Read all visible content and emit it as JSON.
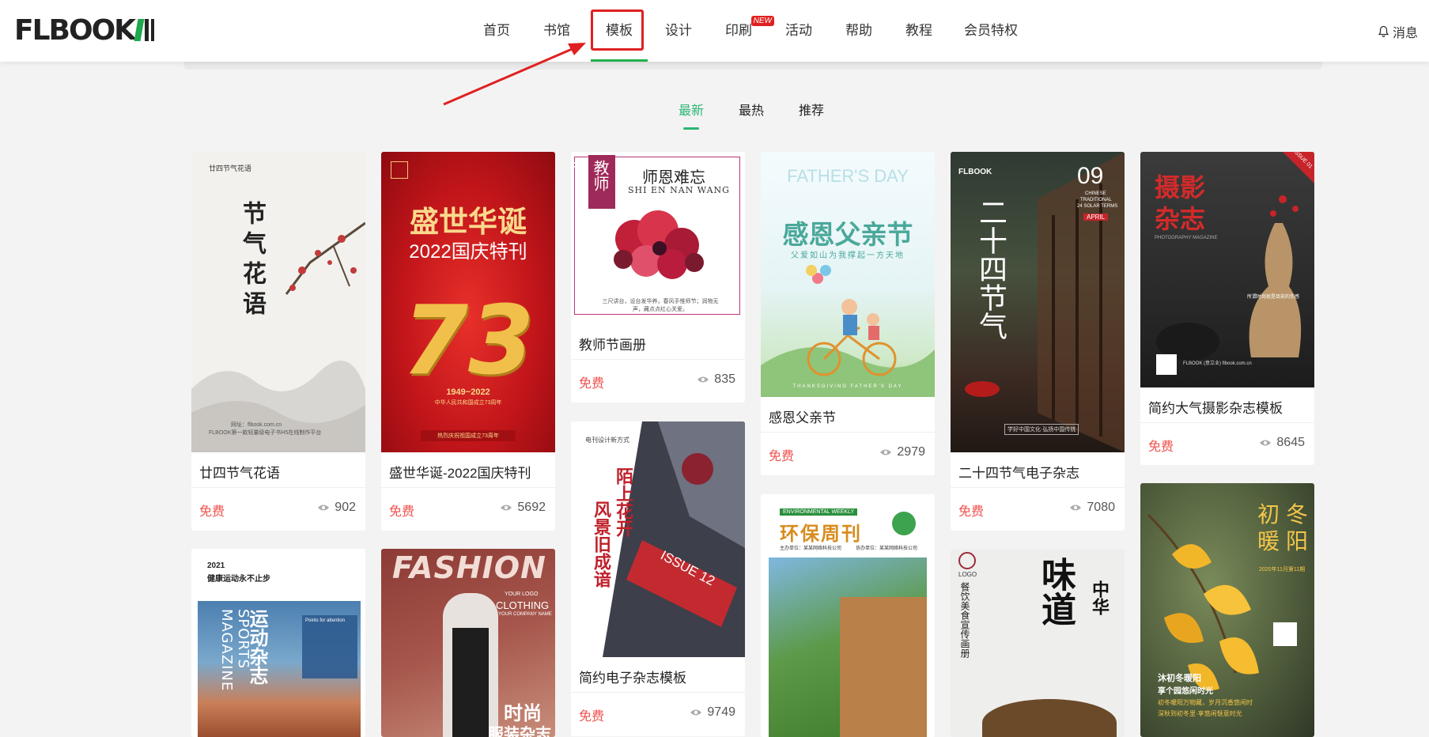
{
  "header": {
    "logo_text": "FLBOOK",
    "nav": [
      {
        "label": "首页"
      },
      {
        "label": "书馆"
      },
      {
        "label": "模板"
      },
      {
        "label": "设计"
      },
      {
        "label": "印刷",
        "badge": "NEW"
      },
      {
        "label": "活动"
      },
      {
        "label": "帮助"
      },
      {
        "label": "教程"
      },
      {
        "label": "会员特权"
      }
    ],
    "active_nav": "模板",
    "messages_label": "消息"
  },
  "tabs": [
    {
      "label": "最新",
      "active": true
    },
    {
      "label": "最热",
      "active": false
    },
    {
      "label": "推荐",
      "active": false
    }
  ],
  "colors": {
    "accent_green": "#21b14a",
    "tab_green": "#2bb673",
    "annotation_red": "#e02020",
    "free_red": "#f0524f"
  },
  "cards": [
    {
      "title": "廿四节气花语",
      "price": "免费",
      "views": "902",
      "thumb": {
        "top_label": "廿四节气花语",
        "main": "节气花语",
        "footer": "网址：flbook.com.cn",
        "footer2": "FLBOOK第一款轻量级电子书H5在线制作平台"
      }
    },
    {
      "title": "盛世华诞-2022国庆特刊",
      "price": "免费",
      "views": "5692",
      "thumb": {
        "headline": "盛世华诞",
        "subhead": "2022国庆特刊",
        "number": "73",
        "years": "1949~2022",
        "caption": "中华人民共和国成立73周年",
        "strip": "热烈庆祝祖国成立73周年"
      }
    },
    {
      "title": "教师节画册",
      "price": "免费",
      "views": "835",
      "thumb": {
        "side": "教师节",
        "heading": "师恩难忘",
        "sub": "SHI EN NAN WANG",
        "poem": "三尺讲台，设台发华养，春风手惟师节；润物无声，藏点点红心关爱。"
      }
    },
    {
      "title": "感恩父亲节",
      "price": "免费",
      "views": "2979",
      "thumb": {
        "en": "FATHER'S DAY",
        "headline": "感恩父亲节",
        "sub": "父爱如山为我撑起一方天地",
        "bottom": "THANKSGIVING FATHER'S DAY"
      }
    },
    {
      "title": "二十四节气电子杂志",
      "price": "免费",
      "views": "7080",
      "thumb": {
        "brand": "FLBOOK",
        "number": "09",
        "en1": "CHINESE",
        "en2": "TRADITIONAL",
        "en3": "24 SOLAR TERMS",
        "month": "APRIL",
        "main": "二十四节气",
        "foot": "学好中国文化·弘扬中国传统"
      }
    },
    {
      "title": "简约大气摄影杂志模板",
      "price": "免费",
      "views": "8645",
      "thumb": {
        "issue": "ISSUE 01",
        "main1": "摄影",
        "main2": "杂志",
        "en": "PHOTOGRAPHY MAGAZINE",
        "note": "所谓时尚就是目前的伤感",
        "footer": "FLBOOK (意立业) flbook.com.cn"
      }
    },
    {
      "title": "",
      "price": "",
      "views": "",
      "thumb": {
        "year": "2021",
        "head": "健康运动永不止步",
        "main": "运动杂志",
        "en": "SPORTS MAGAZINE",
        "box": "Points for attention"
      }
    },
    {
      "title": "",
      "price": "",
      "views": "",
      "thumb": {
        "big": "FASHION",
        "logo": "YOUR LOGO",
        "clothing": "CLOTHING",
        "company": "YOUR COMPANY NAME",
        "main1": "时尚",
        "main2": "服装杂志"
      }
    },
    {
      "title": "简约电子杂志模板",
      "price": "免费",
      "views": "9749",
      "thumb": {
        "label": "电刊设计新方式",
        "main": "陌上花开",
        "main2": "风景旧成谙",
        "issue": "ISSUE 12"
      }
    },
    {
      "title": "",
      "price": "",
      "views": "",
      "thumb": {
        "tag": "ENVIRONMENTAL WEEKLY",
        "main": "环保周刊",
        "host": "主办单位：某某网络科技公司",
        "co": "协办单位：某某网络科技公司"
      }
    },
    {
      "title": "",
      "price": "",
      "views": "",
      "thumb": {
        "logo": "LOGO",
        "side": "餐饮美食宣传画册",
        "main": "味道",
        "red": "中华"
      }
    },
    {
      "title": "",
      "price": "",
      "views": "",
      "thumb": {
        "main1": "初冬",
        "main2": "暖阳",
        "date": "2020年11月第11期",
        "tag1": "沐初冬暖阳",
        "tag2": "享个园悠闲时光",
        "tag3": "初冬暖阳万物藏，岁月沉香悠闲时",
        "tag4": "深秋到初冬里·享悠闲惬意时光"
      }
    }
  ]
}
